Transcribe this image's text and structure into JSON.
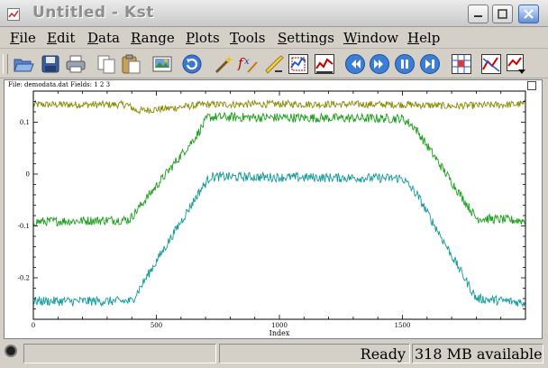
{
  "window": {
    "title": "Untitled - Kst"
  },
  "menu": [
    "File",
    "Edit",
    "Data",
    "Range",
    "Plots",
    "Tools",
    "Settings",
    "Window",
    "Help"
  ],
  "toolbar": {
    "buttons": [
      "open-icon",
      "save-icon",
      "print-icon",
      "copy-icon",
      "paste-icon",
      "export-image-icon",
      "reload-icon",
      "data-wizard-icon",
      "plugin-icon",
      "edit-vector-icon",
      "zoom-xy-icon",
      "zoom-x-icon",
      "back-icon",
      "forward-icon",
      "pause-icon",
      "advance-icon",
      "layout-icon",
      "plot-zoom-icon",
      "graphics-mode-icon"
    ]
  },
  "plot": {
    "file_label": "File: demodata.dat   Fields: 1 2 3",
    "xlabel": "Index"
  },
  "chart_data": {
    "type": "line",
    "title": "File: demodata.dat   Fields: 1 2 3",
    "xlabel": "Index",
    "ylabel": "",
    "xlim": [
      0,
      2000
    ],
    "ylim": [
      -0.28,
      0.16
    ],
    "x_ticks": [
      0,
      500,
      1000,
      1500
    ],
    "y_ticks": [
      0.1,
      0,
      -0.1,
      -0.2
    ],
    "x_tick_labels": [
      "0",
      "500",
      "1000",
      "1500"
    ],
    "y_tick_labels": [
      "0.1",
      "0",
      "-0.1",
      "-0.2"
    ],
    "grid": false,
    "series": [
      {
        "color": "#8a8a00",
        "noise": 0.007,
        "points": [
          [
            0,
            0.134
          ],
          [
            380,
            0.134
          ],
          [
            420,
            0.122
          ],
          [
            560,
            0.127
          ],
          [
            690,
            0.134
          ],
          [
            1000,
            0.135
          ],
          [
            1520,
            0.134
          ],
          [
            1700,
            0.131
          ],
          [
            2000,
            0.135
          ]
        ]
      },
      {
        "color": "#1a9e1a",
        "noise": 0.009,
        "points": [
          [
            0,
            -0.092
          ],
          [
            390,
            -0.088
          ],
          [
            660,
            0.072
          ],
          [
            710,
            0.11
          ],
          [
            1500,
            0.107
          ],
          [
            1550,
            0.09
          ],
          [
            1800,
            -0.085
          ],
          [
            2000,
            -0.09
          ]
        ]
      },
      {
        "color": "#12999a",
        "noise": 0.009,
        "points": [
          [
            0,
            -0.245
          ],
          [
            400,
            -0.245
          ],
          [
            680,
            -0.03
          ],
          [
            720,
            -0.005
          ],
          [
            1500,
            -0.008
          ],
          [
            1560,
            -0.04
          ],
          [
            1800,
            -0.24
          ],
          [
            2000,
            -0.248
          ]
        ]
      }
    ]
  },
  "status": {
    "message": "Ready",
    "memory": "318 MB available"
  }
}
